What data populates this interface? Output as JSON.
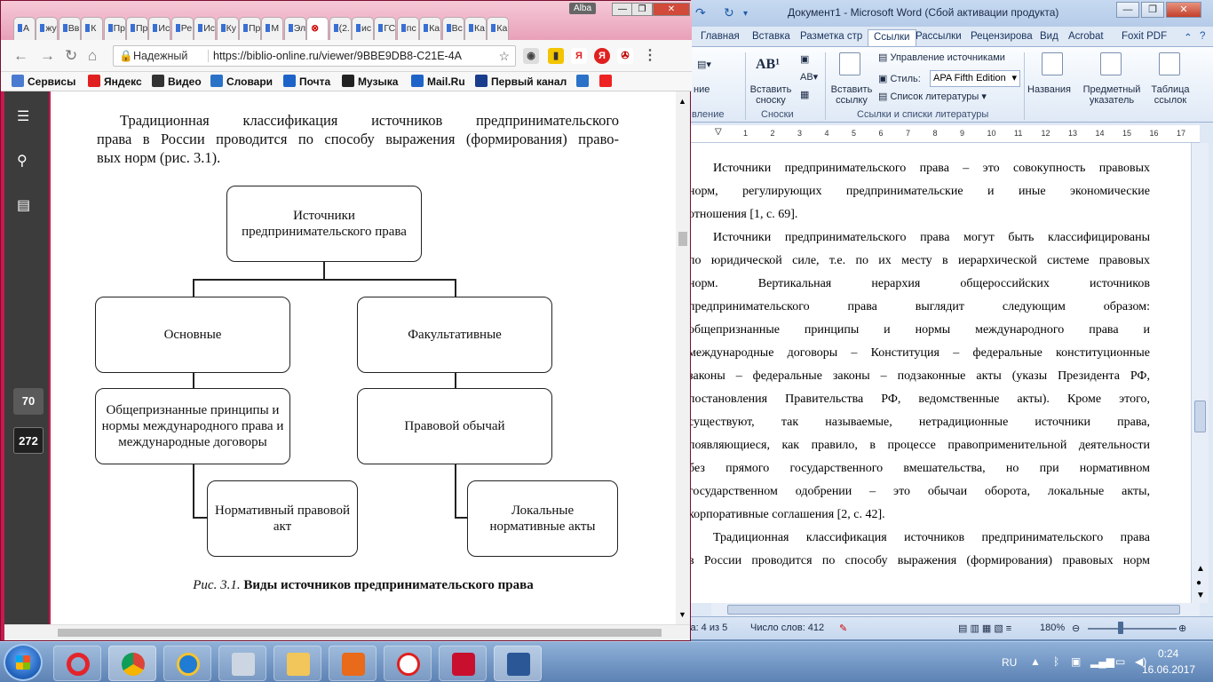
{
  "word": {
    "title": "Документ1 - Microsoft Word (Сбой активации продукта)",
    "tabs": [
      "Главная",
      "Вставка",
      "Разметка стр",
      "Ссылки",
      "Рассылки",
      "Рецензирова",
      "Вид",
      "Acrobat",
      "Foxit PDF"
    ],
    "active_tab": "Ссылки",
    "ribbon": {
      "ae_label": "ние",
      "insert_footnote": "Вставить сноску",
      "insert_citation": "Вставить ссылку",
      "manage_sources": "Управление источниками",
      "style_label": "Стиль:",
      "style_value": "APA Fifth Edition",
      "bibliography": "Список литературы",
      "captions": "Названия",
      "index": "Предметный указатель",
      "toa": "Таблица ссылок",
      "group_toc": "вление",
      "group_footnotes": "Сноски",
      "group_citations": "Ссылки и списки литературы"
    },
    "ruler_numbers": [
      "1",
      "2",
      "3",
      "4",
      "5",
      "6",
      "7",
      "8",
      "9",
      "10",
      "11",
      "12",
      "13",
      "14",
      "15",
      "16",
      "17"
    ],
    "body": {
      "p1_lines": [
        "Источники предпринимательского права – это совокупность правовых",
        "норм, регулирующих предпринимательские и иные экономические",
        "отношения [1, с. 69]."
      ],
      "p2_lines": [
        "Источники предпринимательского права могут быть классифицированы",
        "по юридической силе, т.е. по их месту в иерархической системе правовых",
        "норм. Вертикальная нерархия общероссийских источников",
        "предпринимательского права выглядит следующим образом:",
        "общепризнанные принципы и нормы международного права и",
        "международные договоры – Конституция – федеральные конституционные",
        "законы – федеральные законы – подзаконные акты (указы Президента РФ,",
        "постановления Правительства РФ, ведомственные акты). Кроме этого,",
        "существуют, так называемые, нетрадиционные источники права,",
        "появляющиеся, как правило, в процессе правоприменительной деятельности",
        "без прямого государственного вмешательства, но при нормативном",
        "государственном одобрении – это обычаи оборота, локальные акты,",
        "корпоративные соглашения [2, с. 42]."
      ],
      "p3_lines": [
        "Традиционная классификация источников предпринимательского права",
        "в России проводится по способу выражения (формирования) правовых норм"
      ]
    },
    "status": {
      "page": "ица: 4 из 5",
      "words": "Число слов: 412",
      "zoom": "180%"
    }
  },
  "chrome": {
    "tabs": [
      "А",
      "жу",
      "Вв",
      "К",
      "Пр",
      "Пр",
      "Ис",
      "Ре",
      "Ис",
      "Ку",
      "Пр",
      "М",
      "Эл",
      "",
      "(2.",
      "ис",
      "ГС",
      "пс",
      "Ка",
      "Вс",
      "Ка",
      "Ка"
    ],
    "profile": "Alba",
    "secure_label": "Надежный",
    "url": "https://biblio-online.ru/viewer/9BBE9DB8-C21E-4A",
    "bookmarks": [
      "Сервисы",
      "Яндекс",
      "Видео",
      "Словари",
      "Почта",
      "Музыка",
      "Mail.Ru",
      "Первый канал"
    ],
    "page_current": "70",
    "page_total": "272"
  },
  "book": {
    "intro_lines": [
      "Традиционная классификация источников предпринимательского",
      "права в России проводится по способу выражения (формирования) право-",
      "вых норм (рис. 3.1)."
    ],
    "diagram": {
      "root": "Источники предпринимательского права",
      "left": "Основные",
      "right": "Факультативные",
      "left_child": "Общепризнанные принципы и нормы международного права и международные договоры",
      "right_child": "Правовой обычай",
      "left_leaf": "Нормативный правовой акт",
      "right_leaf": "Локальные нормативные акты"
    },
    "caption_num": "Рис. 3.1.",
    "caption_text": "Виды источников предпринимательского права"
  },
  "taskbar": {
    "lang": "RU",
    "time": "0:24",
    "date": "16.06.2017"
  },
  "colors": {
    "chrome_frame": "#c8184f",
    "word_ribbon": "#dfe8f5",
    "reader_sidebar": "#3c3c3c",
    "page_box_active": "#5a5a5a"
  }
}
